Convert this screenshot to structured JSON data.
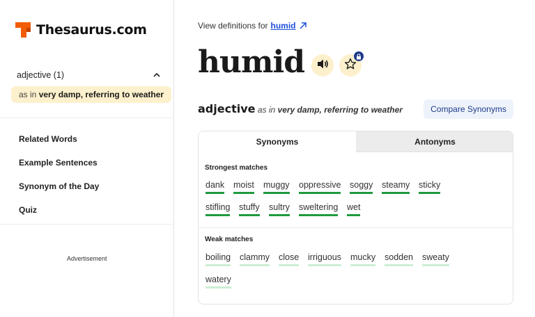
{
  "brand": {
    "name": "Thesaurus.com"
  },
  "sidebar": {
    "pos_title": "adjective (1)",
    "sense_prefix": "as in",
    "sense_text": "very damp, referring to weather",
    "nav": [
      "Related Words",
      "Example Sentences",
      "Synonym of the Day",
      "Quiz"
    ],
    "ad_label": "Advertisement"
  },
  "main": {
    "view_def_prefix": "View definitions for",
    "view_def_link": "humid",
    "headword": "humid",
    "pos_word": "adjective",
    "as_in": "as in",
    "sense_text": "very damp, referring to weather",
    "compare_label": "Compare Synonyms"
  },
  "tabs": {
    "synonyms": "Synonyms",
    "antonyms": "Antonyms"
  },
  "strong": {
    "label": "Strongest matches",
    "words": [
      "dank",
      "moist",
      "muggy",
      "oppressive",
      "soggy",
      "steamy",
      "sticky",
      "stifling",
      "stuffy",
      "sultry",
      "sweltering",
      "wet"
    ]
  },
  "weak": {
    "label": "Weak matches",
    "words": [
      "boiling",
      "clammy",
      "close",
      "irriguous",
      "mucky",
      "sodden",
      "sweaty",
      "watery"
    ]
  },
  "colors": {
    "accent": "#f25c05",
    "strong": "#1f9a3e",
    "weak": "#cdeed4",
    "highlight": "#fdf0cc",
    "link": "#1d4ed8"
  },
  "icons": [
    "logo-icon",
    "chevron-up-icon",
    "external-link-icon",
    "speaker-icon",
    "star-icon",
    "lock-icon"
  ]
}
